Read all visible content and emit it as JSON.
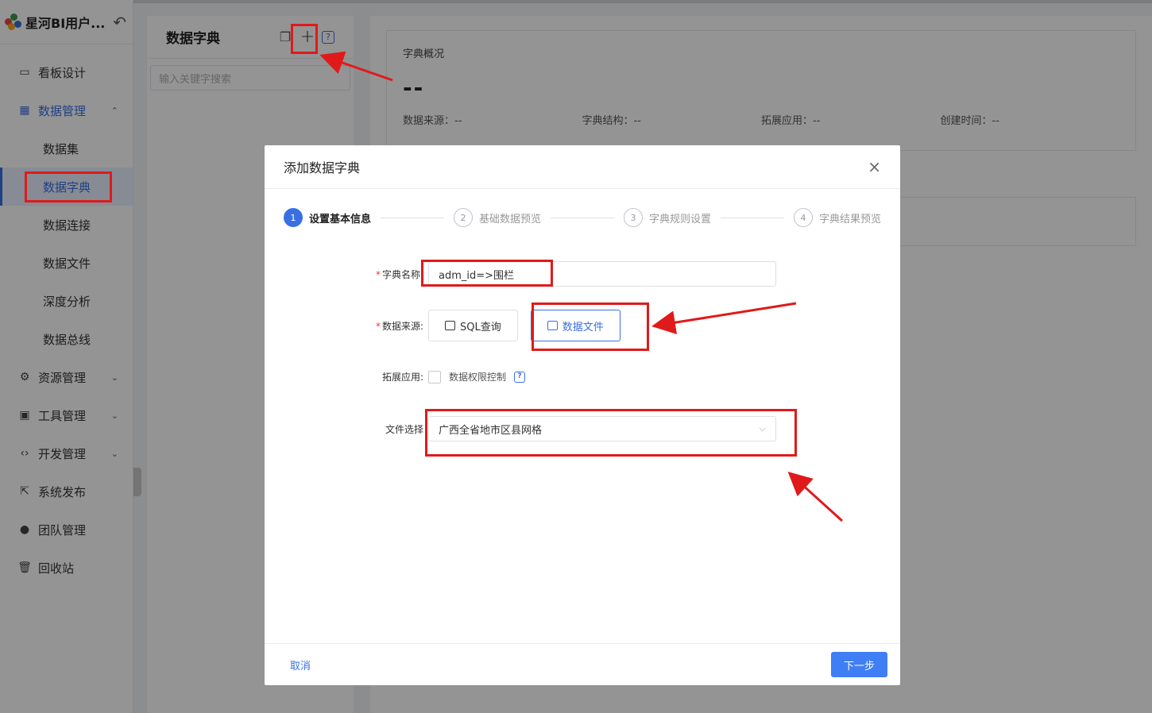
{
  "brand": {
    "title": "星河BI用户..."
  },
  "sidebar": {
    "items": [
      {
        "label": "看板设计",
        "icon": "monitor-icon"
      },
      {
        "label": "数据管理",
        "icon": "data-chart-icon",
        "chevron": "⌃"
      },
      {
        "label": "数据集"
      },
      {
        "label": "数据字典"
      },
      {
        "label": "数据连接"
      },
      {
        "label": "数据文件"
      },
      {
        "label": "深度分析"
      },
      {
        "label": "数据总线"
      },
      {
        "label": "资源管理",
        "icon": "resource-icon",
        "chevron": "⌄"
      },
      {
        "label": "工具管理",
        "icon": "toolbox-icon",
        "chevron": "⌄"
      },
      {
        "label": "开发管理",
        "icon": "code-icon",
        "chevron": "⌄"
      },
      {
        "label": "系统发布",
        "icon": "publish-icon"
      },
      {
        "label": "团队管理",
        "icon": "team-icon"
      },
      {
        "label": "回收站",
        "icon": "trash-icon"
      }
    ]
  },
  "dict_panel": {
    "title": "数据字典",
    "search_placeholder": "输入关键字搜索"
  },
  "overview": {
    "title": "字典概况",
    "value": "--",
    "fields": [
      "数据来源：--",
      "字典结构：--",
      "拓展应用：--",
      "创建时间：--"
    ]
  },
  "dialog": {
    "title": "添加数据字典",
    "close": "×",
    "steps": [
      {
        "num": "1",
        "label": "设置基本信息"
      },
      {
        "num": "2",
        "label": "基础数据预览"
      },
      {
        "num": "3",
        "label": "字典规则设置"
      },
      {
        "num": "4",
        "label": "字典结果预览"
      }
    ],
    "name_label": "字典名称:",
    "name_value": "adm_id=>围栏",
    "source_label": "数据来源:",
    "source_sql": "SQL查询",
    "source_file": "数据文件",
    "ext_label": "拓展应用:",
    "ext_option": "数据权限控制",
    "file_label": "文件选择",
    "file_value": "广西全省地市区县网格",
    "cancel": "取消",
    "next": "下一步"
  },
  "colors": {
    "accent": "#3a6fe2",
    "highlight": "#e01a1a"
  }
}
